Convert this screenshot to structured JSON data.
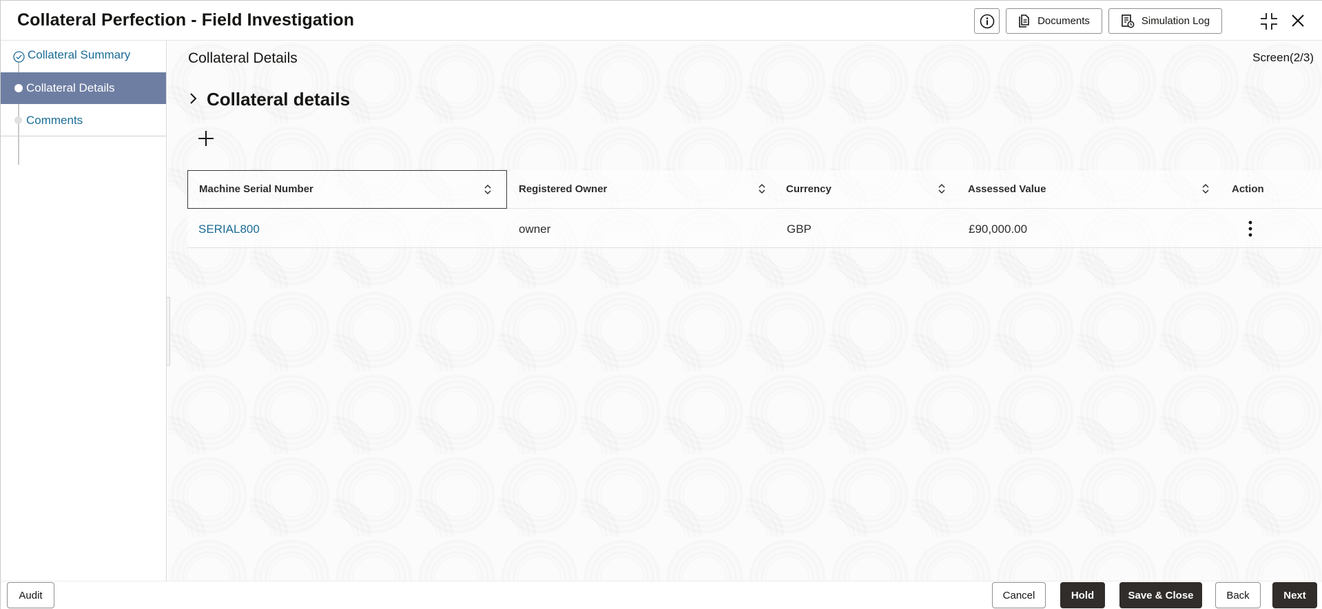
{
  "header": {
    "title": "Collateral Perfection - Field Investigation",
    "documents_label": "Documents",
    "simulation_log_label": "Simulation Log"
  },
  "sidebar": {
    "items": [
      {
        "label": "Collateral Summary",
        "state": "completed"
      },
      {
        "label": "Collateral Details",
        "state": "current"
      },
      {
        "label": "Comments",
        "state": "pending"
      }
    ]
  },
  "main": {
    "section_title": "Collateral Details",
    "screen_indicator": "Screen(2/3)",
    "subsection_title": "Collateral details",
    "table": {
      "columns": [
        "Machine Serial Number",
        "Registered Owner",
        "Currency",
        "Assessed Value",
        "Action"
      ],
      "rows": [
        {
          "serial": "SERIAL800",
          "owner": "owner",
          "currency": "GBP",
          "assessed_value": "£90,000.00"
        }
      ]
    }
  },
  "footer": {
    "audit_label": "Audit",
    "cancel_label": "Cancel",
    "hold_label": "Hold",
    "save_close_label": "Save & Close",
    "back_label": "Back",
    "next_label": "Next"
  },
  "colors": {
    "accent_link": "#1b6c95",
    "sidebar_active_bg": "#6e7ea3",
    "primary_button_bg": "#312d2a"
  }
}
